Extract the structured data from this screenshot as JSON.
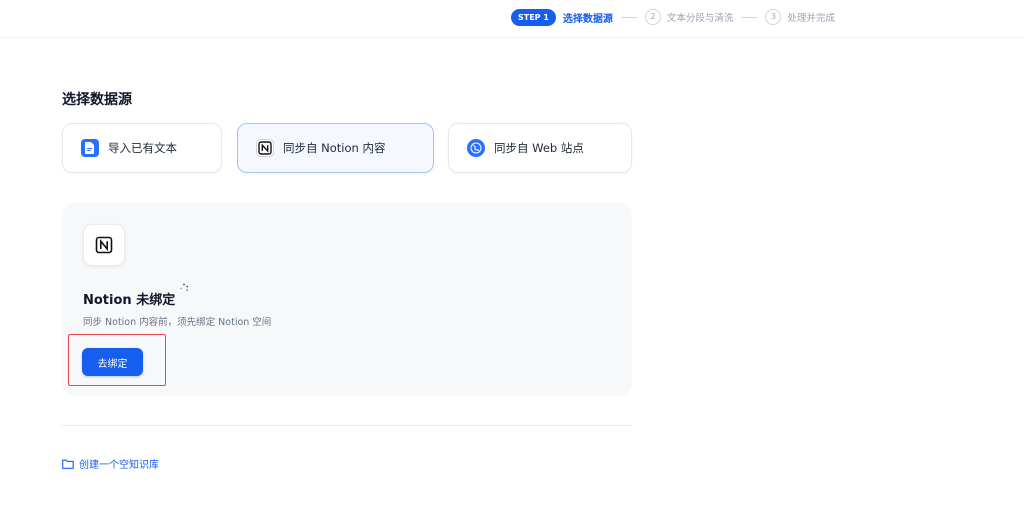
{
  "stepper": {
    "active_badge": "STEP 1",
    "active_label": "选择数据源",
    "steps": [
      {
        "num": "2",
        "label": "文本分段与清洗"
      },
      {
        "num": "3",
        "label": "处理并完成"
      }
    ]
  },
  "main": {
    "section_title": "选择数据源",
    "sources": [
      {
        "label": "导入已有文本",
        "icon": "file-doc-icon",
        "selected": false
      },
      {
        "label": "同步自 Notion 内容",
        "icon": "notion-icon",
        "selected": true
      },
      {
        "label": "同步自 Web 站点",
        "icon": "web-globe-icon",
        "selected": false
      }
    ],
    "notion_panel": {
      "title": "Notion 未绑定",
      "description": "同步 Notion 内容前，须先绑定 Notion 空间",
      "button_label": "去绑定"
    },
    "create_link": {
      "label": "创建一个空知识库",
      "icon": "folder-icon"
    }
  },
  "colors": {
    "accent": "#155eef",
    "highlight": "#e5484d",
    "panel_bg": "#f7f8fa"
  }
}
